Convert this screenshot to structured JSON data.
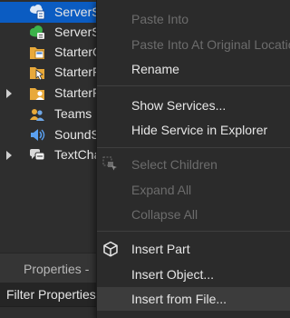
{
  "explorer": {
    "items": [
      {
        "label": "ServerS",
        "icon": "server-storage-icon",
        "selected": true
      },
      {
        "label": "ServerS",
        "icon": "server-script-service-icon"
      },
      {
        "label": "StarterG",
        "icon": "starter-gui-icon"
      },
      {
        "label": "StarterF",
        "icon": "starter-pack-icon"
      },
      {
        "label": "StarterF",
        "icon": "starter-player-icon",
        "expandable": true
      },
      {
        "label": "Teams",
        "icon": "teams-icon"
      },
      {
        "label": "SoundS",
        "icon": "sound-service-icon"
      },
      {
        "label": "TextCha",
        "icon": "text-chat-service-icon",
        "expandable": true
      }
    ]
  },
  "properties": {
    "title": "Properties -",
    "filter_placeholder": "Filter Properties"
  },
  "context_menu": {
    "paste_into": "Paste Into",
    "paste_into_original_location": "Paste Into At Original Location",
    "rename": "Rename",
    "show_services": "Show Services...",
    "hide_service": "Hide Service in Explorer",
    "select_children": "Select Children",
    "expand_all": "Expand All",
    "collapse_all": "Collapse All",
    "insert_part": "Insert Part",
    "insert_object": "Insert Object...",
    "insert_from_file": "Insert from File..."
  },
  "colors": {
    "selection": "#0b5cc2",
    "panel_bg": "#2e2e2e",
    "menu_bg": "#2b2b2b",
    "disabled_text": "#6c6c6c",
    "text": "#e6e6e6"
  }
}
